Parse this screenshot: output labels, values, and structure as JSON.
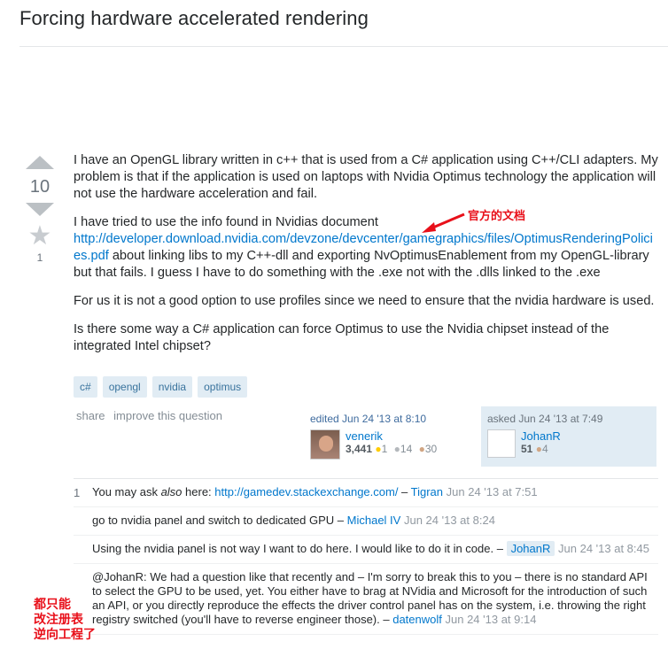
{
  "question": {
    "title": "Forcing hardware accelerated rendering",
    "vote_count": "10",
    "favorite_count": "1",
    "paragraphs": [
      "I have an OpenGL library written in c++ that is used from a C# application using C++/CLI adapters. My problem is that if the application is used on laptops with Nvidia Optimus technology the application will not use the hardware acceleration and fail.",
      "For us it is not a good option to use profiles since we need to ensure that the nvidia hardware is used.",
      "Is there some way a C# application can force Optimus to use the Nvidia chipset instead of the integrated Intel chipset?"
    ],
    "p2_before": "I have tried to use the info found in Nvidias document",
    "p2_link": "http://developer.download.nvidia.com/devzone/devcenter/gamegraphics/files/OptimusRenderingPolicies.pdf",
    "p2_after": " about linking libs to my C++-dll and exporting NvOptimusEnablement from my OpenGL-library but that fails. I guess I have to do something with the .exe not with the .dlls linked to the .exe",
    "tags": [
      "c#",
      "opengl",
      "nvidia",
      "optimus"
    ],
    "menu": {
      "share": "share",
      "improve": "improve this question"
    }
  },
  "editor": {
    "action": "edited Jun 24 '13 at 8:10",
    "name": "venerik",
    "rep": "3,441",
    "gold": "1",
    "silver": "14",
    "bronze": "30"
  },
  "owner": {
    "action": "asked Jun 24 '13 at 7:49",
    "name": "JohanR",
    "rep": "51",
    "bronze": "4"
  },
  "annotations": {
    "official_doc": "官方的文档",
    "reverse_engineer": [
      "都只能",
      "改注册表",
      "逆向工程了"
    ]
  },
  "comments": [
    {
      "score": "1",
      "pre": "You may ask ",
      "em": "also",
      "post": " here: ",
      "link": "http://gamedev.stackexchange.com/",
      "sep": " – ",
      "user": "Tigran",
      "date": "Jun 24 '13 at 7:51"
    },
    {
      "text": "go to nvidia panel and switch to dedicated GPU",
      "sep": " – ",
      "user": "Michael IV",
      "date": "Jun 24 '13 at 8:24"
    },
    {
      "text": "Using the nvidia panel is not way I want to do here. I would like to do it in code.",
      "sep": " – ",
      "user": "JohanR",
      "date": "Jun 24 '13 at 8:45"
    },
    {
      "text": "@JohanR: We had a question like that recently and – I'm sorry to break this to you – there is no standard API to select the GPU to be used, yet. You either have to brag at NVidia and Microsoft for the introduction of such an API, or you directly reproduce the effects the driver control panel has on the system, i.e. throwing the right registry switched (you'll have to reverse engineer those).",
      "sep": " – ",
      "user": "datenwolf",
      "date": "Jun 24 '13 at 9:14"
    }
  ]
}
